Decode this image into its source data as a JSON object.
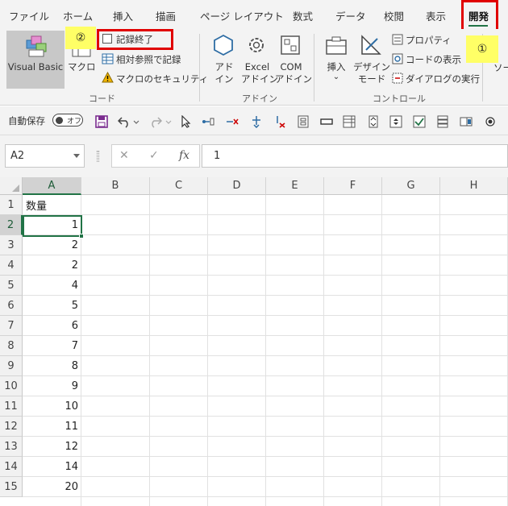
{
  "ribbon_tabs": [
    "ファイル",
    "ホーム",
    "挿入",
    "描画",
    "ページ レイアウト",
    "数式",
    "データ",
    "校閲",
    "表示",
    "開発"
  ],
  "active_tab": "開発",
  "annotations": {
    "marker1": "①",
    "marker2": "②"
  },
  "code_group": {
    "label": "コード",
    "visual_basic": "Visual Basic",
    "macro": "マクロ",
    "stop_recording": "記録終了",
    "relative_reference": "相対参照で記録",
    "macro_security": "マクロのセキュリティ"
  },
  "addin_group": {
    "label": "アドイン",
    "addin_line1": "アド",
    "addin_line2": "イン",
    "excel_line1": "Excel",
    "excel_line2": "アドイン",
    "com_line1": "COM",
    "com_line2": "アドイン"
  },
  "controls_group": {
    "label": "コントロール",
    "insert": "挿入",
    "insert_arrow": "⌄",
    "design_line1": "デザイン",
    "design_line2": "モード",
    "properties": "プロパティ",
    "view_code": "コードの表示",
    "run_dialog": "ダイアログの実行",
    "cutoff": "ソー"
  },
  "quick_access": {
    "autosave_label": "自動保存",
    "toggle_state": "オフ"
  },
  "formula_bar": {
    "name_box": "A2",
    "fx_label": "fx",
    "cancel": "✕",
    "confirm": "✓",
    "content": "1"
  },
  "columns": [
    "A",
    "B",
    "C",
    "D",
    "E",
    "F",
    "G",
    "H"
  ],
  "selected_column": "A",
  "rows": [
    "1",
    "2",
    "3",
    "4",
    "5",
    "6",
    "7",
    "8",
    "9",
    "10",
    "11",
    "12",
    "13",
    "14",
    "15"
  ],
  "selected_row": "2",
  "column_a_values": [
    "数量",
    "1",
    "2",
    "2",
    "4",
    "5",
    "6",
    "7",
    "8",
    "9",
    "10",
    "11",
    "12",
    "14",
    "20"
  ],
  "colors": {
    "excel_green": "#217346",
    "highlight_red": "#e00000",
    "marker_yellow": "#ffff66"
  }
}
